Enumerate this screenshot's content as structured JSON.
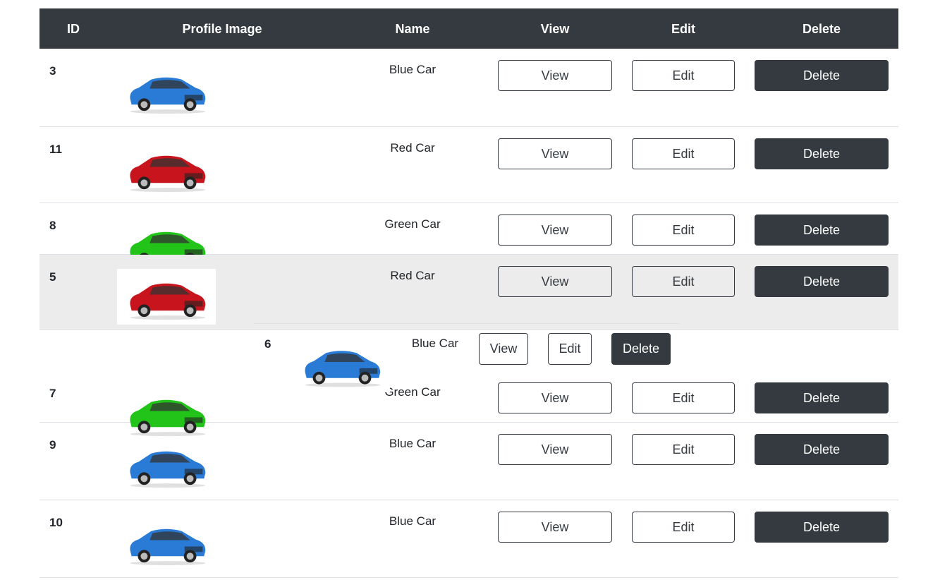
{
  "headers": {
    "id": "ID",
    "image": "Profile Image",
    "name": "Name",
    "view": "View",
    "edit": "Edit",
    "delete": "Delete"
  },
  "buttons": {
    "view": "View",
    "edit": "Edit",
    "delete": "Delete"
  },
  "colors": {
    "header_bg": "#343a40",
    "hover_row": "#ececec",
    "blue": "#2a7bd6",
    "red": "#c8141c",
    "green": "#22c41a"
  },
  "rows": [
    {
      "id": "3",
      "name": "Blue Car",
      "car": "blue"
    },
    {
      "id": "11",
      "name": "Red Car",
      "car": "red"
    },
    {
      "id": "8",
      "name": "Green Car",
      "car": "green"
    },
    {
      "id": "5",
      "name": "Red Car",
      "car": "red"
    },
    {
      "id": "7",
      "name": "Green Car",
      "car": "green"
    },
    {
      "id": "9",
      "name": "Blue Car",
      "car": "blue"
    },
    {
      "id": "10",
      "name": "Blue Car",
      "car": "blue"
    }
  ],
  "dragged_row": {
    "id": "6",
    "name": "Blue Car",
    "car": "blue"
  }
}
